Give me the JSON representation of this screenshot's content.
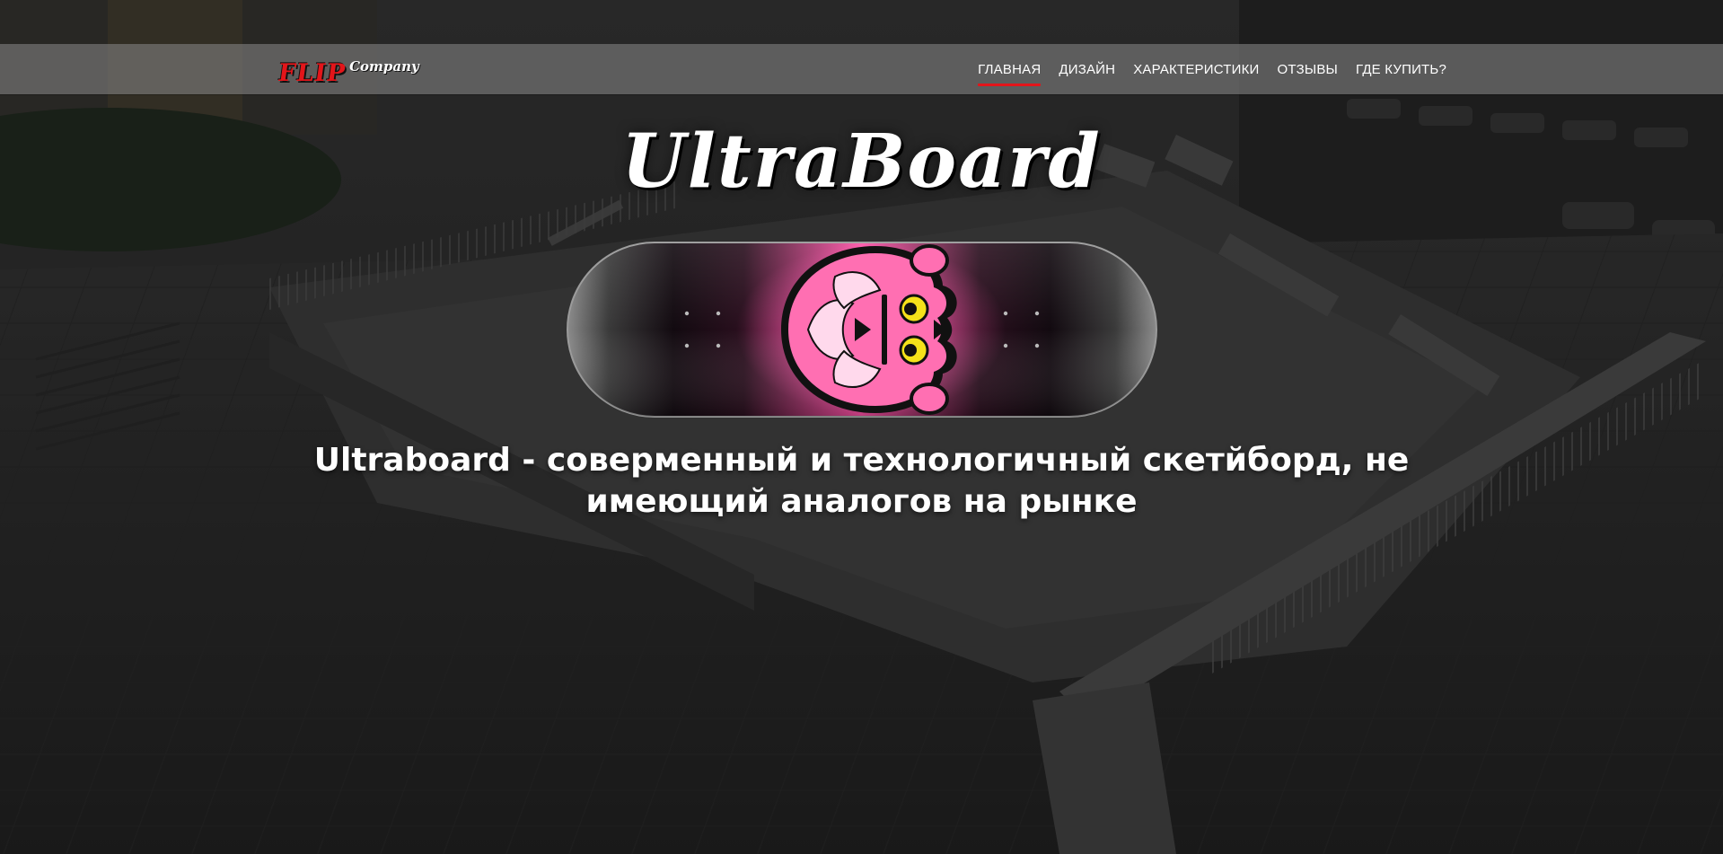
{
  "header": {
    "logo": {
      "brand": "FLIP",
      "sub": "Company"
    },
    "nav": [
      {
        "label": "ГЛАВНАЯ",
        "active": true
      },
      {
        "label": "ДИЗАЙН",
        "active": false
      },
      {
        "label": "ХАРАКТЕРИСТИКИ",
        "active": false
      },
      {
        "label": "ОТЗЫВЫ",
        "active": false
      },
      {
        "label": "ГДЕ КУПИТЬ?",
        "active": false
      }
    ]
  },
  "hero": {
    "title": "UltraBoard",
    "board_graphic": "pink-skull-panther-icon",
    "tagline_line1": "Ultraboard - соверменный и технологичный скетйборд, не",
    "tagline_line2": "имеющий аналогов на рынке"
  },
  "colors": {
    "accent": "#e3151a",
    "header_bg": "#808080",
    "board_pink": "#ff3f9a"
  }
}
